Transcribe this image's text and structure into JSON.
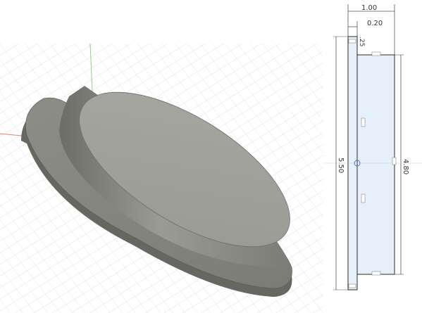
{
  "viewport": {
    "background": "#ffffff",
    "grid_color": "#d9d9d9",
    "axis_red": "#e08080",
    "axis_green": "#8fd08f",
    "model_color": "#9a9a94"
  },
  "sketch": {
    "dimensions": {
      "overall_width": "1.00",
      "flange_width": "0.20",
      "flange_height": "5.50",
      "small_gap": ".25",
      "body_height": "4.80"
    },
    "fill_color": "#e6f0fa",
    "line_color": "#2a2a2a"
  }
}
